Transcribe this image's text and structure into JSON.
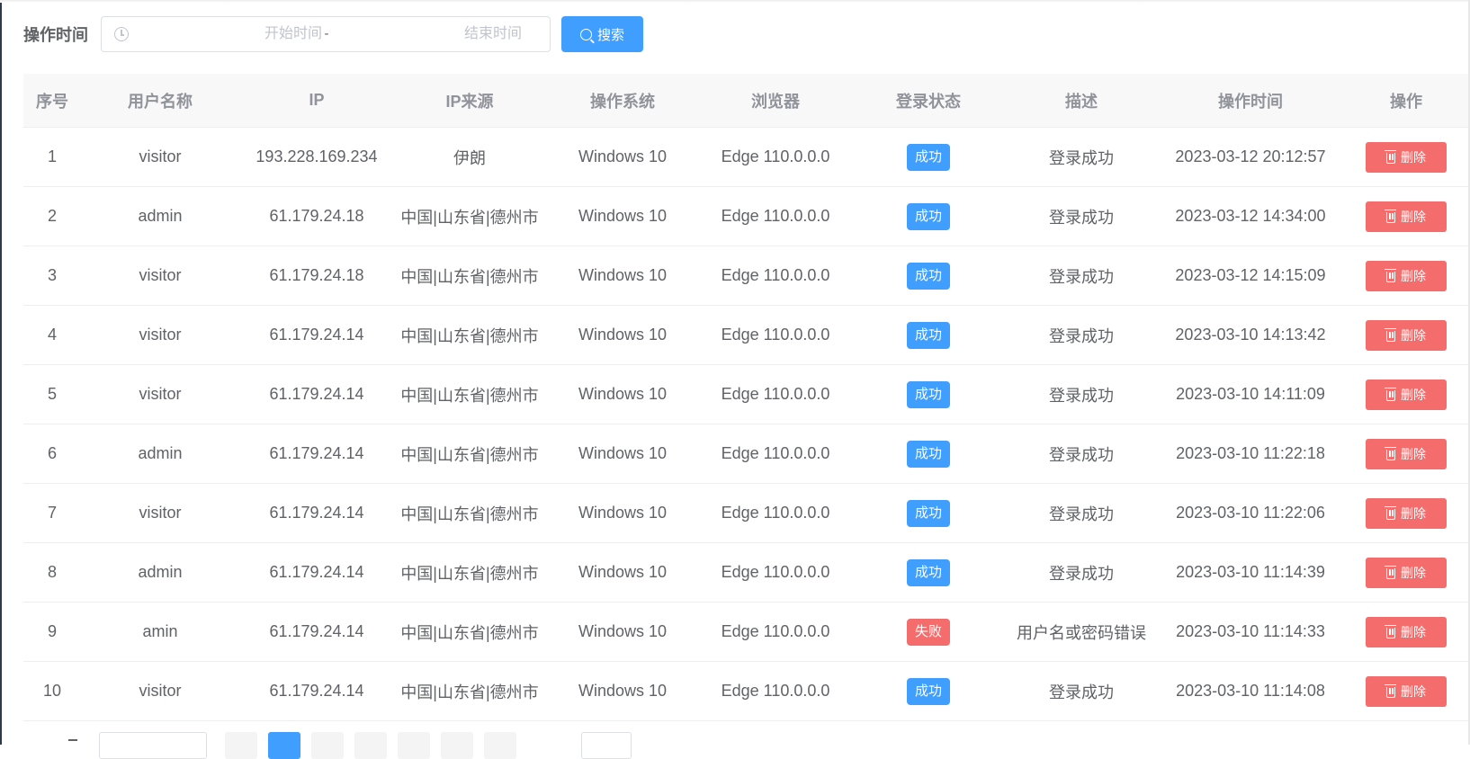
{
  "filter": {
    "label": "操作时间",
    "start_placeholder": "开始时间",
    "separator": "-",
    "end_placeholder": "结束时间",
    "search_label": "搜索"
  },
  "table": {
    "headers": [
      "序号",
      "用户名称",
      "IP",
      "IP来源",
      "操作系统",
      "浏览器",
      "登录状态",
      "描述",
      "操作时间",
      "操作"
    ],
    "delete_label": "删除",
    "rows": [
      {
        "index": "1",
        "user": "visitor",
        "ip": "193.228.169.234",
        "source": "伊朗",
        "os": "Windows 10",
        "browser": "Edge 110.0.0.0",
        "status": "成功",
        "status_type": "success",
        "desc": "登录成功",
        "time": "2023-03-12 20:12:57"
      },
      {
        "index": "2",
        "user": "admin",
        "ip": "61.179.24.18",
        "source": "中国|山东省|德州市",
        "os": "Windows 10",
        "browser": "Edge 110.0.0.0",
        "status": "成功",
        "status_type": "success",
        "desc": "登录成功",
        "time": "2023-03-12 14:34:00"
      },
      {
        "index": "3",
        "user": "visitor",
        "ip": "61.179.24.18",
        "source": "中国|山东省|德州市",
        "os": "Windows 10",
        "browser": "Edge 110.0.0.0",
        "status": "成功",
        "status_type": "success",
        "desc": "登录成功",
        "time": "2023-03-12 14:15:09"
      },
      {
        "index": "4",
        "user": "visitor",
        "ip": "61.179.24.14",
        "source": "中国|山东省|德州市",
        "os": "Windows 10",
        "browser": "Edge 110.0.0.0",
        "status": "成功",
        "status_type": "success",
        "desc": "登录成功",
        "time": "2023-03-10 14:13:42"
      },
      {
        "index": "5",
        "user": "visitor",
        "ip": "61.179.24.14",
        "source": "中国|山东省|德州市",
        "os": "Windows 10",
        "browser": "Edge 110.0.0.0",
        "status": "成功",
        "status_type": "success",
        "desc": "登录成功",
        "time": "2023-03-10 14:11:09"
      },
      {
        "index": "6",
        "user": "admin",
        "ip": "61.179.24.14",
        "source": "中国|山东省|德州市",
        "os": "Windows 10",
        "browser": "Edge 110.0.0.0",
        "status": "成功",
        "status_type": "success",
        "desc": "登录成功",
        "time": "2023-03-10 11:22:18"
      },
      {
        "index": "7",
        "user": "visitor",
        "ip": "61.179.24.14",
        "source": "中国|山东省|德州市",
        "os": "Windows 10",
        "browser": "Edge 110.0.0.0",
        "status": "成功",
        "status_type": "success",
        "desc": "登录成功",
        "time": "2023-03-10 11:22:06"
      },
      {
        "index": "8",
        "user": "admin",
        "ip": "61.179.24.14",
        "source": "中国|山东省|德州市",
        "os": "Windows 10",
        "browser": "Edge 110.0.0.0",
        "status": "成功",
        "status_type": "success",
        "desc": "登录成功",
        "time": "2023-03-10 11:14:39"
      },
      {
        "index": "9",
        "user": "amin",
        "ip": "61.179.24.14",
        "source": "中国|山东省|德州市",
        "os": "Windows 10",
        "browser": "Edge 110.0.0.0",
        "status": "失败",
        "status_type": "fail",
        "desc": "用户名或密码错误",
        "time": "2023-03-10 11:14:33"
      },
      {
        "index": "10",
        "user": "visitor",
        "ip": "61.179.24.14",
        "source": "中国|山东省|德州市",
        "os": "Windows 10",
        "browser": "Edge 110.0.0.0",
        "status": "成功",
        "status_type": "success",
        "desc": "登录成功",
        "time": "2023-03-10 11:14:08"
      }
    ]
  },
  "colors": {
    "primary": "#409eff",
    "danger": "#f56c6c",
    "header_bg": "#f8f8f9"
  },
  "icons": {
    "range": "clock-icon",
    "search": "search-icon",
    "delete": "trash-icon"
  }
}
